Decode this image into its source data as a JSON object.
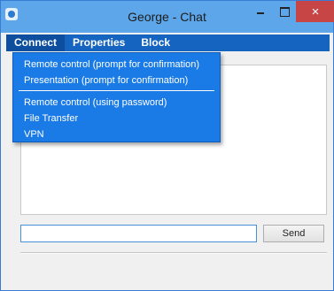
{
  "window": {
    "title": "George - Chat"
  },
  "controls": {
    "close_glyph": "×"
  },
  "menubar": {
    "items": [
      "Connect",
      "Properties",
      "Block"
    ]
  },
  "dropdown": {
    "items": [
      "Remote control (prompt for confirmation)",
      "Presentation (prompt for confirmation)",
      "Remote control (using password)",
      "File Transfer",
      "VPN"
    ]
  },
  "chat": {
    "input_value": "",
    "send_label": "Send"
  },
  "colors": {
    "menubar": "#1564c0",
    "dropdown": "#1a7be6",
    "titlebar": "#5da6ea",
    "close": "#c74545"
  }
}
